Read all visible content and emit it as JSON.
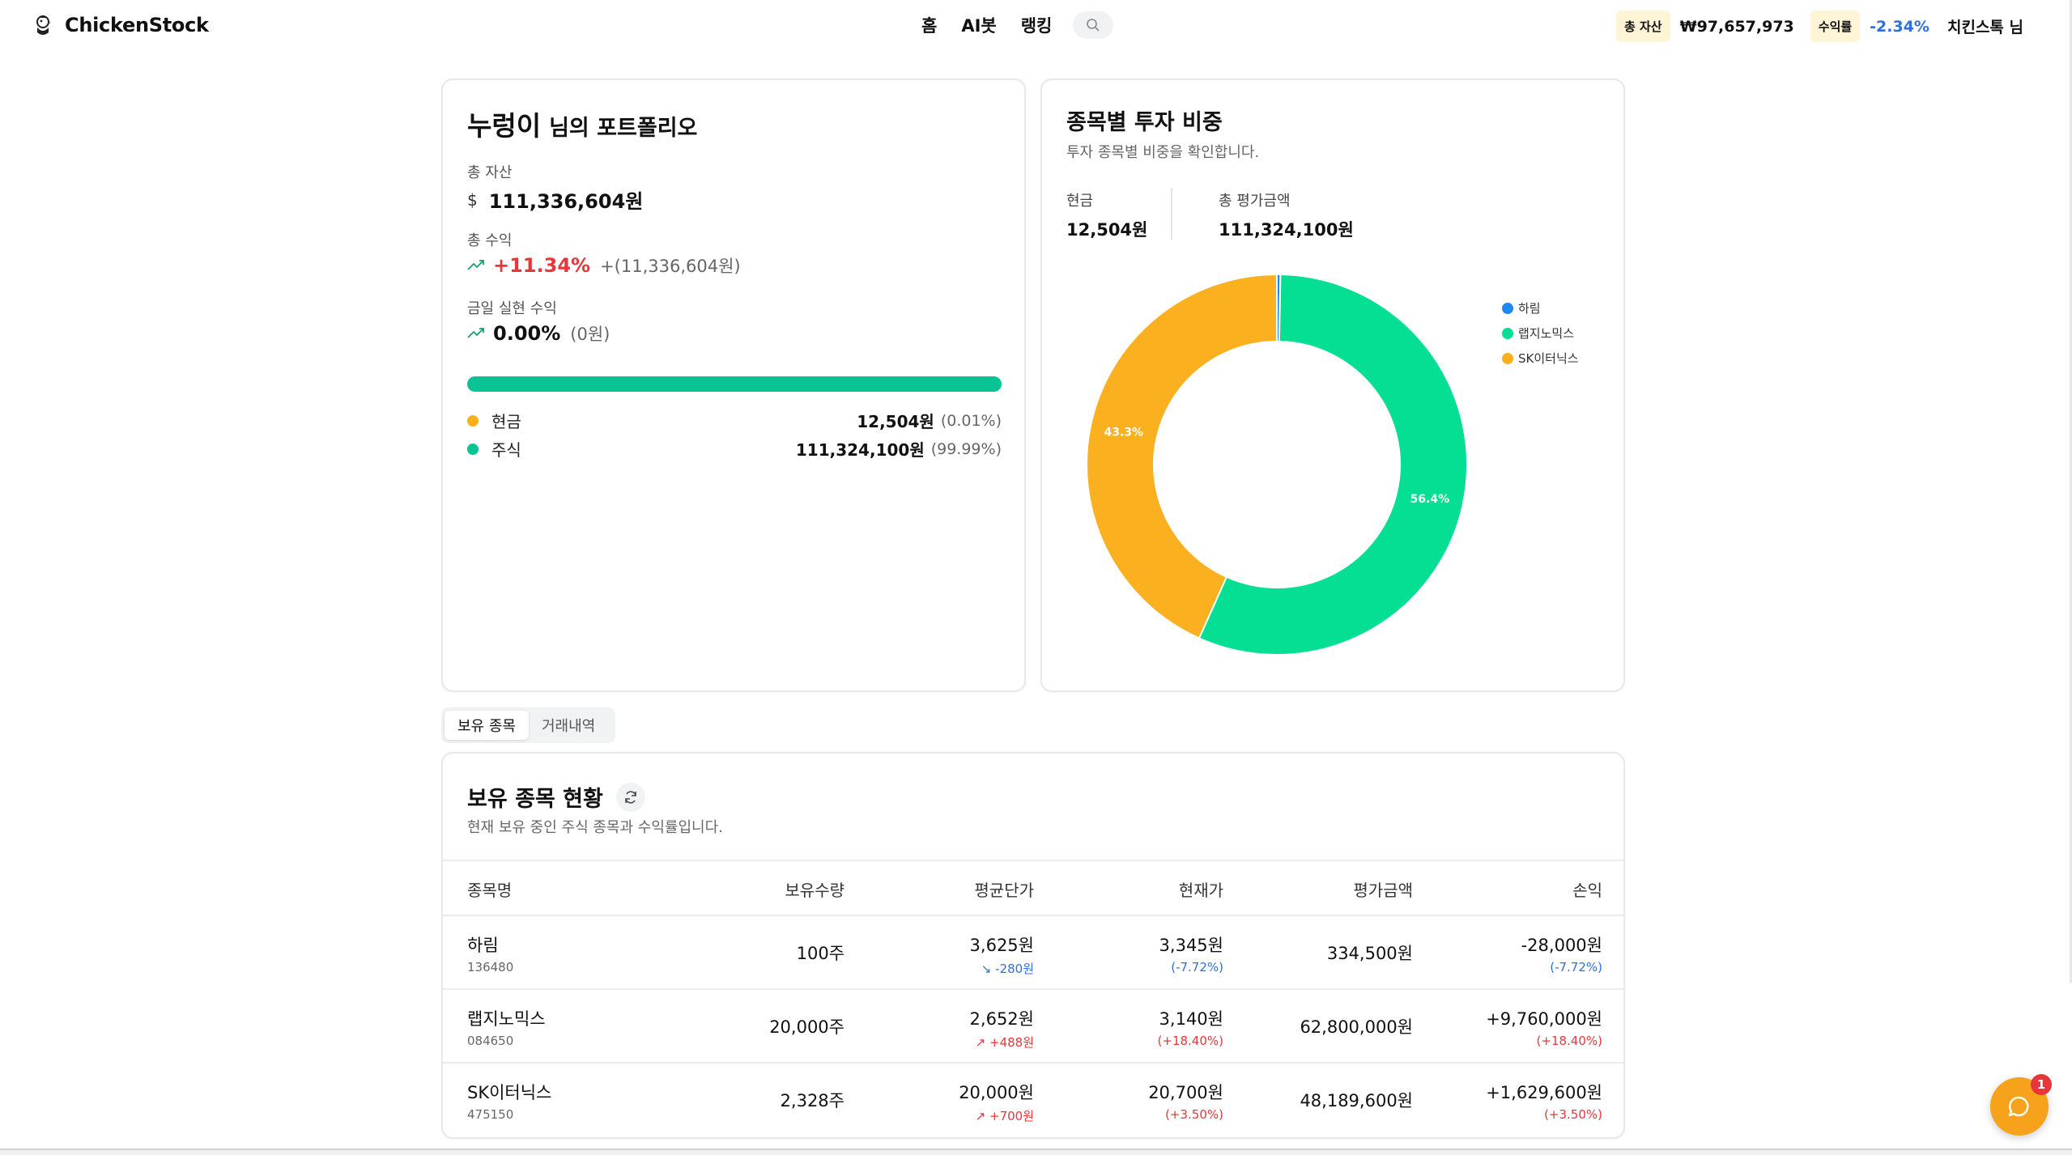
{
  "header": {
    "brand": "ChickenStock",
    "nav": [
      "홈",
      "AI봇",
      "랭킹"
    ],
    "total_assets_chip": "총 자산",
    "total_assets_value": "₩97,657,973",
    "return_chip": "수익률",
    "return_value": "-2.34%",
    "user": "치킨스톡 님"
  },
  "portfolio": {
    "name": "누렁이",
    "suffix": "님의 포트폴리오",
    "total_assets_label": "총 자산",
    "currency_symbol": "$",
    "total_assets_value": "111,336,604원",
    "total_profit_label": "총 수익",
    "total_profit_pct": "+11.34%",
    "total_profit_amount": "+(11,336,604원)",
    "today_label": "금일 실현 수익",
    "today_pct": "0.00%",
    "today_amount": "(0원)",
    "stock_ratio": 0.9999,
    "legend": [
      {
        "label": "현금",
        "value": "12,504원",
        "pct": "(0.01%)",
        "color": "#f7b21b"
      },
      {
        "label": "주식",
        "value": "111,324,100원",
        "pct": "(99.99%)",
        "color": "#08c494"
      }
    ]
  },
  "allocation": {
    "title": "종목별 투자 비중",
    "desc": "투자 종목별 비중을 확인합니다.",
    "cash_label": "현금",
    "cash_value": "12,504원",
    "eval_label": "총 평가금액",
    "eval_value": "111,324,100원",
    "chart_data": {
      "type": "pie",
      "series": [
        {
          "name": "하림",
          "value": 0.3,
          "color": "#1e88f0"
        },
        {
          "name": "랩지노믹스",
          "value": 56.4,
          "color": "#04df94"
        },
        {
          "name": "SK이터닉스",
          "value": 43.3,
          "color": "#fbb020"
        }
      ],
      "labels": [
        "56.4%",
        "43.3%"
      ],
      "legend": "top-right"
    }
  },
  "tabs": [
    "보유 종목",
    "거래내역"
  ],
  "holdings": {
    "title": "보유 종목 현황",
    "desc": "현재 보유 중인 주식 종목과 수익률입니다.",
    "columns": [
      "종목명",
      "보유수량",
      "평균단가",
      "현재가",
      "평가금액",
      "손익"
    ],
    "rows": [
      {
        "name": "하림",
        "code": "136480",
        "qty": "100주",
        "avg": "3,625원",
        "avg_diff": "-280원",
        "price": "3,345원",
        "price_pct": "(-7.72%)",
        "eval": "334,500원",
        "pl": "-28,000원",
        "pl_pct": "(-7.72%)"
      },
      {
        "name": "랩지노믹스",
        "code": "084650",
        "qty": "20,000주",
        "avg": "2,652원",
        "avg_diff": "+488원",
        "price": "3,140원",
        "price_pct": "(+18.40%)",
        "eval": "62,800,000원",
        "pl": "+9,760,000원",
        "pl_pct": "(+18.40%)"
      },
      {
        "name": "SK이터닉스",
        "code": "475150",
        "qty": "2,328주",
        "avg": "20,000원",
        "avg_diff": "+700원",
        "price": "20,700원",
        "price_pct": "(+3.50%)",
        "eval": "48,189,600원",
        "pl": "+1,629,600원",
        "pl_pct": "(+3.50%)"
      }
    ]
  },
  "chat_badge": "1"
}
